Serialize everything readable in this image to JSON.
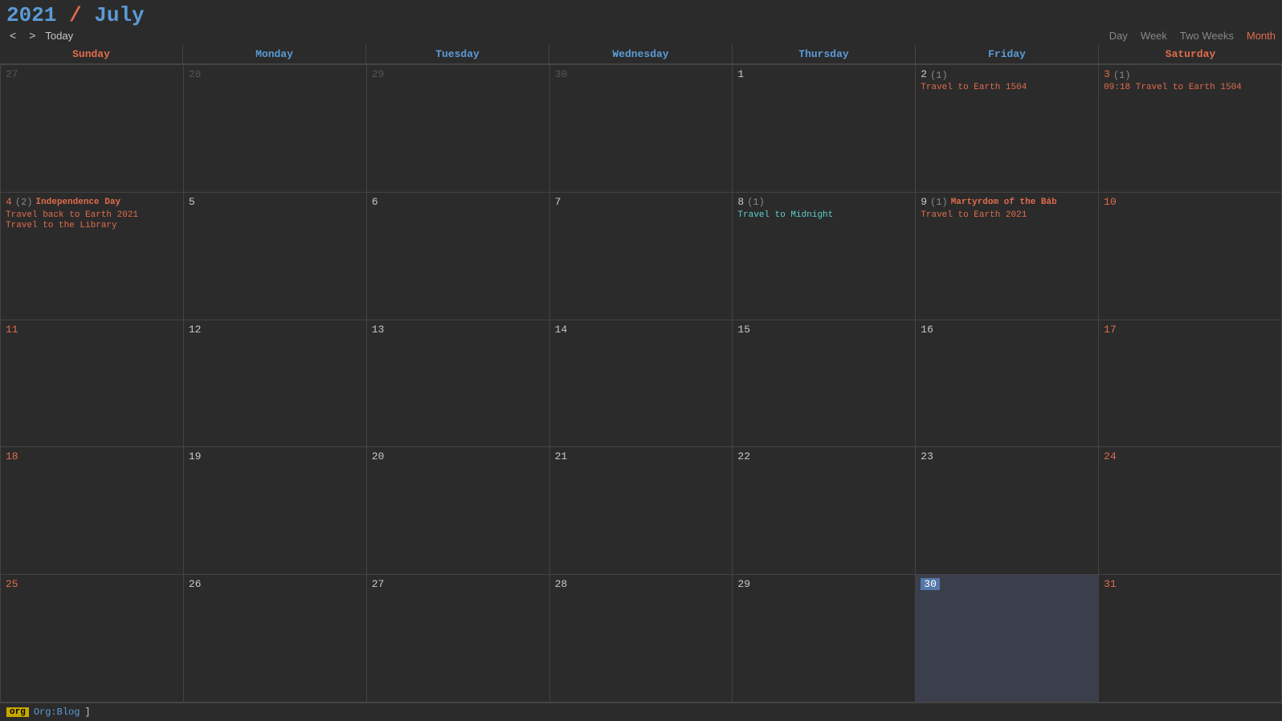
{
  "header": {
    "year": "2021",
    "slash": " / ",
    "month": "July",
    "title_full": "2021 / July",
    "nav_prev": "<",
    "nav_next": ">",
    "today_label": "Today",
    "views": [
      "Day",
      "Week",
      "Two Weeks",
      "Month"
    ],
    "active_view": "Month"
  },
  "day_headers": [
    {
      "label": "Sunday",
      "type": "weekend"
    },
    {
      "label": "Monday",
      "type": "weekday"
    },
    {
      "label": "Tuesday",
      "type": "weekday"
    },
    {
      "label": "Wednesday",
      "type": "weekday"
    },
    {
      "label": "Thursday",
      "type": "weekday"
    },
    {
      "label": "Friday",
      "type": "weekday"
    },
    {
      "label": "Saturday",
      "type": "weekend"
    }
  ],
  "weeks": [
    [
      {
        "day": "27",
        "other_month": true,
        "weekend": false,
        "today": false,
        "events": []
      },
      {
        "day": "28",
        "other_month": true,
        "weekend": false,
        "today": false,
        "events": []
      },
      {
        "day": "29",
        "other_month": true,
        "weekend": false,
        "today": false,
        "events": []
      },
      {
        "day": "30",
        "other_month": true,
        "weekend": false,
        "today": false,
        "events": []
      },
      {
        "day": "1",
        "other_month": false,
        "weekend": false,
        "today": false,
        "events": []
      },
      {
        "day": "2",
        "other_month": false,
        "weekend": false,
        "today": false,
        "count": "(1)",
        "events": [
          {
            "text": "Travel to Earth 1504",
            "style": "orange"
          }
        ]
      },
      {
        "day": "3",
        "other_month": false,
        "weekend": true,
        "today": false,
        "count": "(1)",
        "events": [
          {
            "text": "09:18 Travel to Earth 1504",
            "style": "orange"
          }
        ]
      }
    ],
    [
      {
        "day": "4",
        "other_month": false,
        "weekend": true,
        "today": false,
        "count": "(2)",
        "events": [
          {
            "text": "Independence Day",
            "style": "bold-orange"
          },
          {
            "text": "Travel back to Earth 2021",
            "style": "orange"
          },
          {
            "text": "Travel to the Library",
            "style": "orange"
          }
        ]
      },
      {
        "day": "5",
        "other_month": false,
        "weekend": false,
        "today": false,
        "events": []
      },
      {
        "day": "6",
        "other_month": false,
        "weekend": false,
        "today": false,
        "events": []
      },
      {
        "day": "7",
        "other_month": false,
        "weekend": false,
        "today": false,
        "events": []
      },
      {
        "day": "8",
        "other_month": false,
        "weekend": false,
        "today": false,
        "count": "(1)",
        "events": [
          {
            "text": "Travel to Midnight",
            "style": "cyan"
          }
        ]
      },
      {
        "day": "9",
        "other_month": false,
        "weekend": false,
        "today": false,
        "count": "(1)",
        "bold_text": "Martyrdom of the Báb",
        "events": [
          {
            "text": "Martyrdom of the Báb",
            "style": "bold-orange"
          },
          {
            "text": "Travel to Earth 2021",
            "style": "orange"
          }
        ]
      },
      {
        "day": "10",
        "other_month": false,
        "weekend": true,
        "today": false,
        "events": []
      }
    ],
    [
      {
        "day": "11",
        "other_month": false,
        "weekend": true,
        "today": false,
        "events": []
      },
      {
        "day": "12",
        "other_month": false,
        "weekend": false,
        "today": false,
        "events": []
      },
      {
        "day": "13",
        "other_month": false,
        "weekend": false,
        "today": false,
        "events": []
      },
      {
        "day": "14",
        "other_month": false,
        "weekend": false,
        "today": false,
        "events": []
      },
      {
        "day": "15",
        "other_month": false,
        "weekend": false,
        "today": false,
        "events": []
      },
      {
        "day": "16",
        "other_month": false,
        "weekend": false,
        "today": false,
        "events": []
      },
      {
        "day": "17",
        "other_month": false,
        "weekend": true,
        "today": false,
        "events": []
      }
    ],
    [
      {
        "day": "18",
        "other_month": false,
        "weekend": true,
        "today": false,
        "events": []
      },
      {
        "day": "19",
        "other_month": false,
        "weekend": false,
        "today": false,
        "events": []
      },
      {
        "day": "20",
        "other_month": false,
        "weekend": false,
        "today": false,
        "events": []
      },
      {
        "day": "21",
        "other_month": false,
        "weekend": false,
        "today": false,
        "events": []
      },
      {
        "day": "22",
        "other_month": false,
        "weekend": false,
        "today": false,
        "events": []
      },
      {
        "day": "23",
        "other_month": false,
        "weekend": false,
        "today": false,
        "events": []
      },
      {
        "day": "24",
        "other_month": false,
        "weekend": true,
        "today": false,
        "events": []
      }
    ],
    [
      {
        "day": "25",
        "other_month": false,
        "weekend": true,
        "today": false,
        "events": []
      },
      {
        "day": "26",
        "other_month": false,
        "weekend": false,
        "today": false,
        "events": []
      },
      {
        "day": "27",
        "other_month": false,
        "weekend": false,
        "today": false,
        "events": []
      },
      {
        "day": "28",
        "other_month": false,
        "weekend": false,
        "today": false,
        "events": []
      },
      {
        "day": "29",
        "other_month": false,
        "weekend": false,
        "today": false,
        "events": []
      },
      {
        "day": "30",
        "other_month": false,
        "weekend": false,
        "today": true,
        "events": []
      },
      {
        "day": "31",
        "other_month": false,
        "weekend": true,
        "today": false,
        "events": []
      }
    ]
  ],
  "footer": {
    "tag_label": "org",
    "link_label": "Org:Blog"
  }
}
